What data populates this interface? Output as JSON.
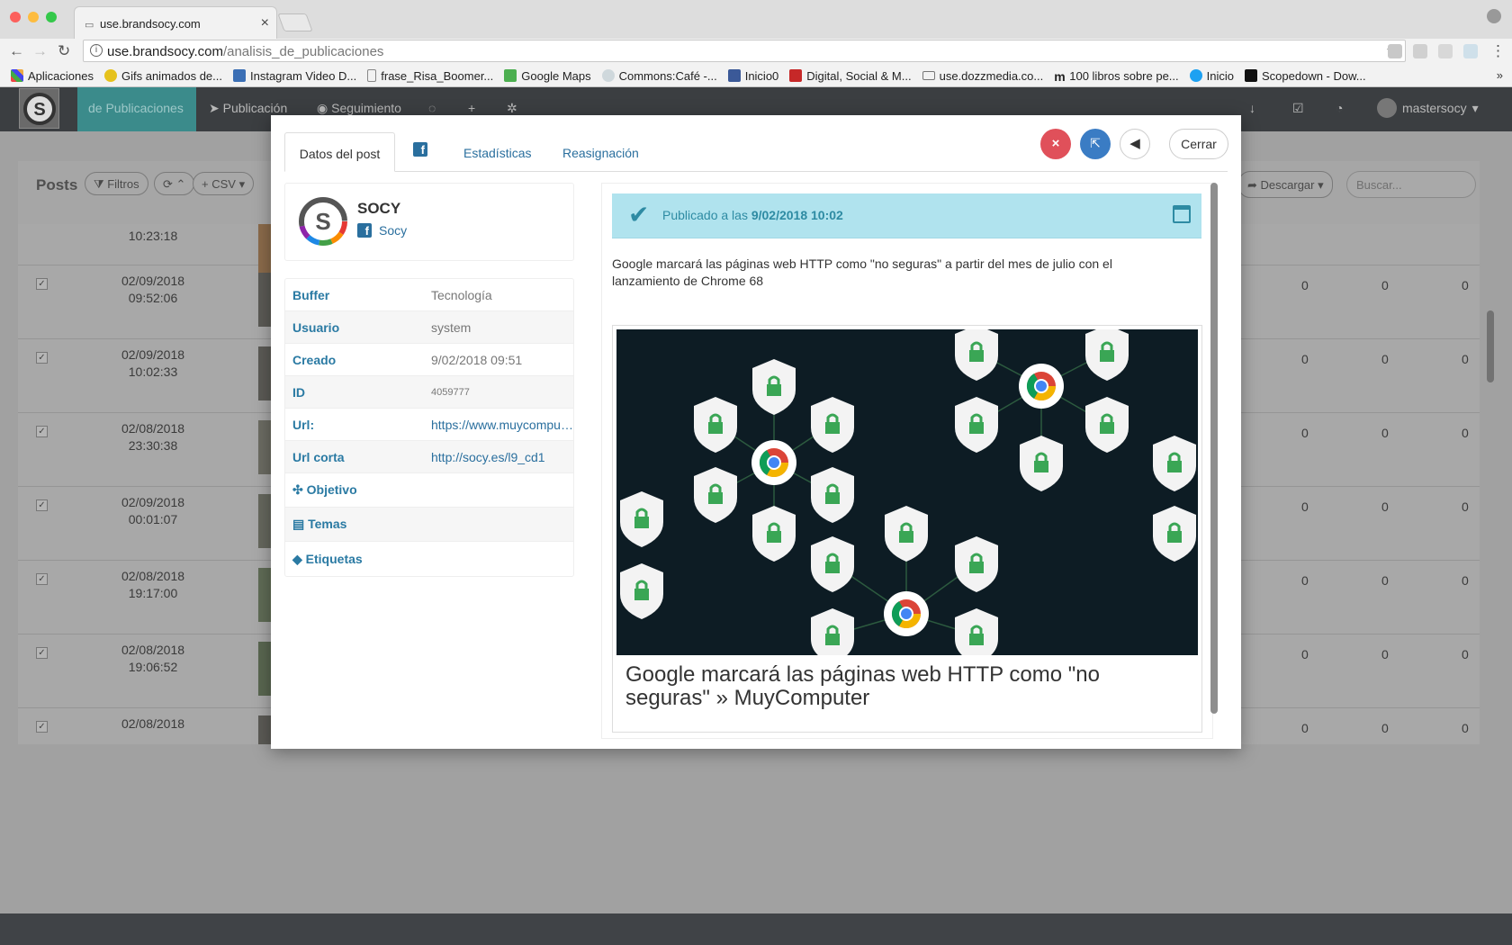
{
  "browser": {
    "tab_title": "use.brandsocy.com",
    "url_host": "use.brandsocy.com",
    "url_path": "/analisis_de_publicaciones",
    "bookmarks": [
      "Aplicaciones",
      "Gifs animados de...",
      "Instagram Video D...",
      "frase_Risa_Boomer...",
      "Google Maps",
      "Commons:Café -...",
      "Inicio0",
      "Digital, Social & M...",
      "use.dozzmedia.co...",
      "100 libros sobre pe...",
      "Inicio",
      "Scopedown - Dow..."
    ],
    "bookmarks_more": "»"
  },
  "app": {
    "nav": [
      "de Publicaciones",
      "Publicación",
      "Seguimiento"
    ],
    "user": "mastersocy",
    "posts_title": "Posts",
    "filters_label": "Filtros",
    "csv_label": "CSV",
    "download_label": "Descargar",
    "search_placeholder": "Buscar...",
    "rows": [
      {
        "date": "",
        "time": "10:23:18"
      },
      {
        "date": "02/09/2018",
        "time": "09:52:06"
      },
      {
        "date": "02/09/2018",
        "time": "10:02:33"
      },
      {
        "date": "02/08/2018",
        "time": "23:30:38"
      },
      {
        "date": "02/09/2018",
        "time": "00:01:07"
      },
      {
        "date": "02/08/2018",
        "time": "19:17:00"
      },
      {
        "date": "02/08/2018",
        "time": "19:06:52"
      },
      {
        "date": "02/08/2018",
        "time": ""
      }
    ],
    "zero": "0"
  },
  "modal": {
    "tabs": [
      "Datos del post",
      "Estadísticas",
      "Reasignación"
    ],
    "close_label": "Cerrar",
    "account_name": "SOCY",
    "account_handle": "Socy",
    "fields": [
      {
        "key": "Buffer",
        "value": "Tecnología"
      },
      {
        "key": "Usuario",
        "value": "system"
      },
      {
        "key": "Creado",
        "value": "9/02/2018 09:51"
      },
      {
        "key": "ID",
        "value": "4059777"
      },
      {
        "key": "Url:",
        "value": "https://www.muycomputer.com"
      },
      {
        "key": "Url corta",
        "value": "http://socy.es/l9_cd1"
      }
    ],
    "sections": [
      "Objetivo",
      "Temas",
      "Etiquetas"
    ],
    "published_prefix": "Publicado a las",
    "published_date": "9/02/2018 10:02",
    "post_text": "Google marcará las páginas web HTTP como \"no seguras\" a partir del mes de julio con el lanzamiento de Chrome 68",
    "preview_title": "Google marcará las páginas web HTTP como \"no seguras\" » MuyComputer"
  },
  "colors": {
    "accent": "#2a6f9e",
    "published_bg": "#b0e3ee",
    "danger": "#e0505a",
    "primary": "#3a7cc4"
  }
}
